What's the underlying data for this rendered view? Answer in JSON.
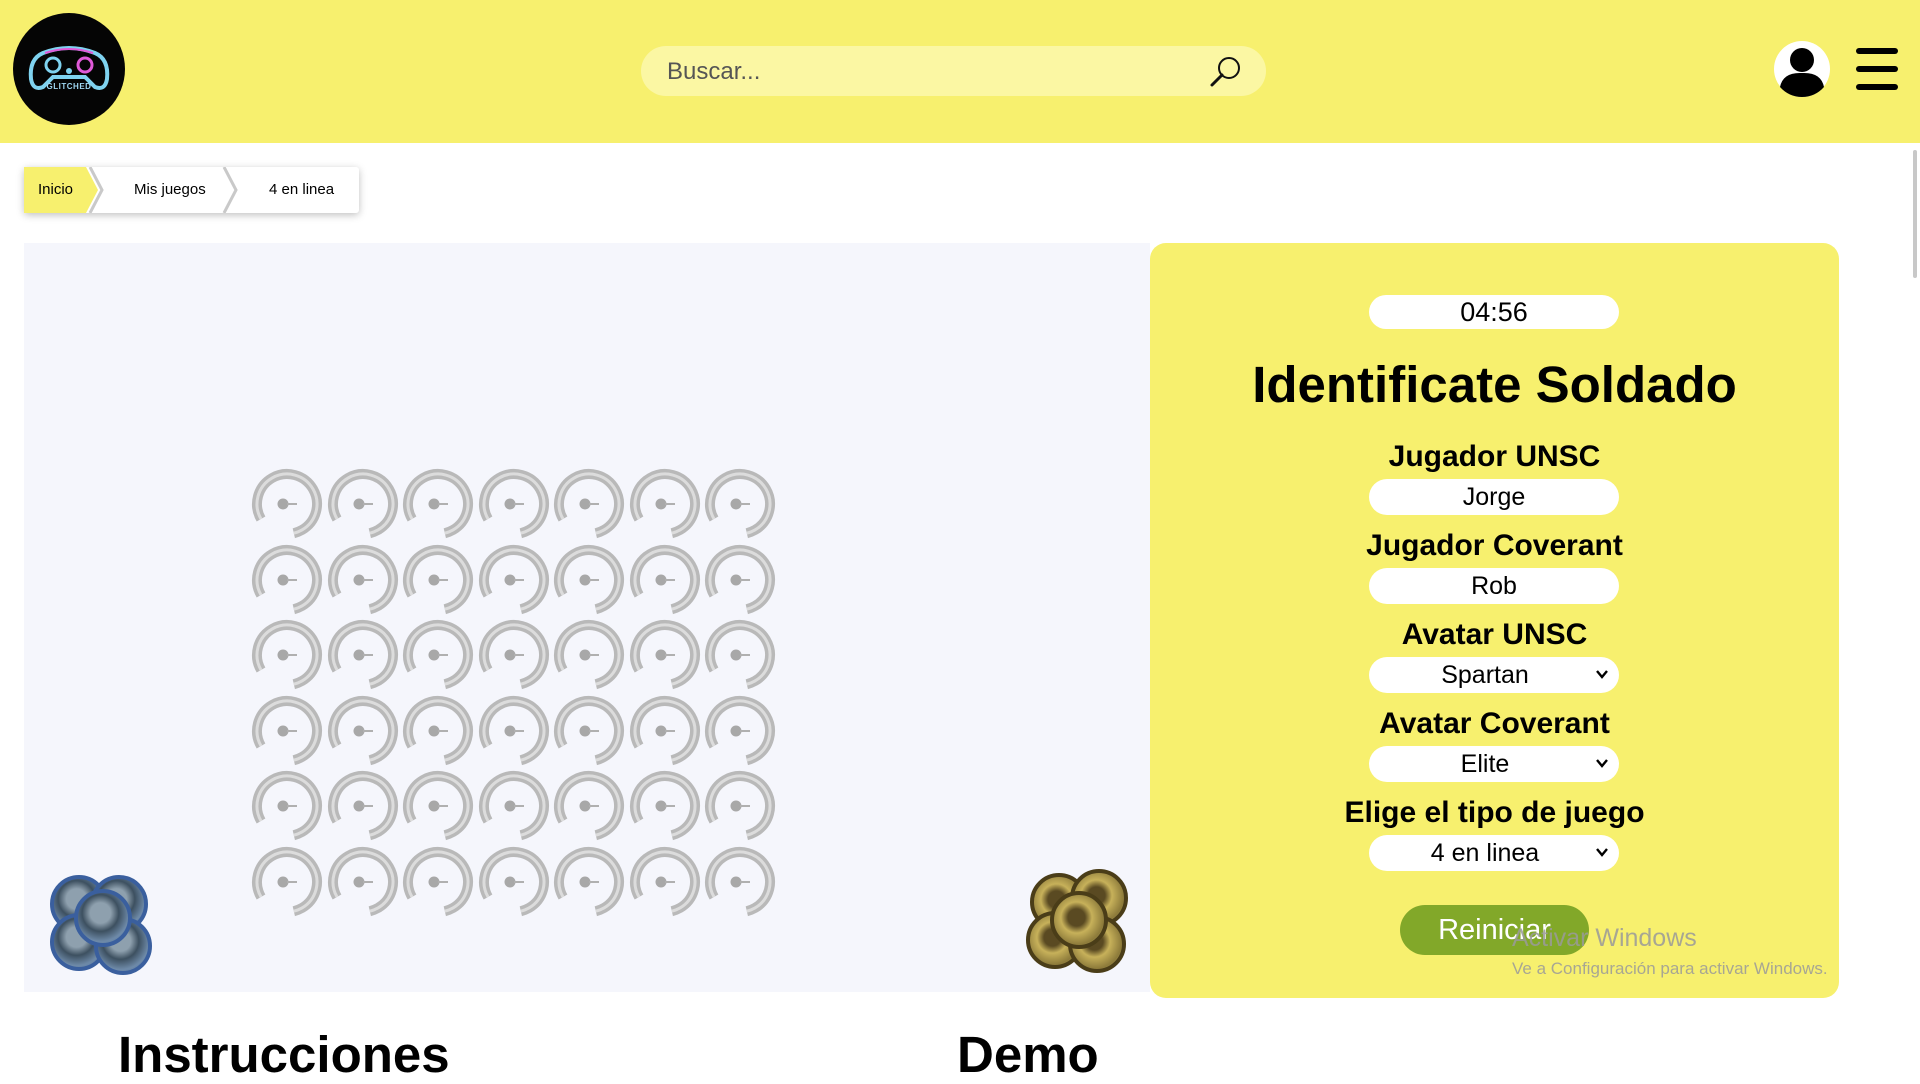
{
  "header": {
    "logo_text": "GLITCHED",
    "search_placeholder": "Buscar...",
    "icons": {
      "search": "search-icon",
      "user": "user-icon",
      "menu": "hamburger-menu-icon"
    },
    "colors": {
      "bar": "#f7f06e",
      "search_bg": "#fbf7a3"
    }
  },
  "breadcrumb": {
    "items": [
      {
        "label": "Inicio"
      },
      {
        "label": "Mis juegos"
      },
      {
        "label": "4 en linea"
      }
    ]
  },
  "board": {
    "rows": 6,
    "columns": 7,
    "player_tokens": {
      "left": "UNSC spartan tokens",
      "right": "Coverant elite tokens"
    }
  },
  "panel": {
    "timer": "04:56",
    "title": "Identificate Soldado",
    "player1_label": "Jugador UNSC",
    "player1_value": "Jorge",
    "player2_label": "Jugador Coverant",
    "player2_value": "Rob",
    "avatar1_label": "Avatar UNSC",
    "avatar1_value": "Spartan",
    "avatar2_label": "Avatar Coverant",
    "avatar2_value": "Elite",
    "gametype_label": "Elige el tipo de juego",
    "gametype_value": "4 en linea",
    "restart_label": "Reiniciar",
    "colors": {
      "panel": "#f7f06e",
      "restart": "#82a829"
    }
  },
  "watermark": {
    "title": "Activar Windows",
    "subtitle": "Ve a Configuración para activar Windows."
  },
  "sections": {
    "instructions": "Instrucciones",
    "demo": "Demo"
  }
}
